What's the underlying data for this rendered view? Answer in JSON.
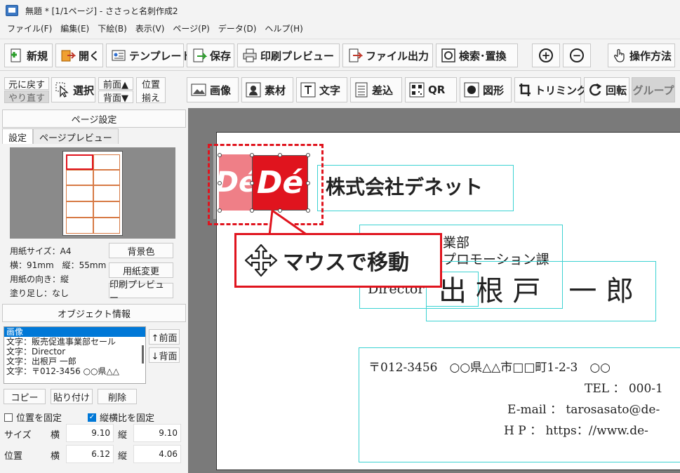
{
  "window": {
    "title": "無題 * [1/1ページ] - ささっと名刺作成2"
  },
  "menu": [
    "ファイル(F)",
    "編集(E)",
    "下絵(B)",
    "表示(V)",
    "ページ(P)",
    "データ(D)",
    "ヘルプ(H)"
  ],
  "toolbar1": {
    "new": "新規",
    "open": "開く",
    "template": "テンプレート",
    "save": "保存",
    "print_preview": "印刷プレビュー",
    "file_output": "ファイル出力",
    "search_replace": "検索･置換",
    "help": "操作方法"
  },
  "toolbar2": {
    "undo": "元に戻す",
    "redo": "やり直す",
    "select": "選択",
    "front": "前面▲",
    "back": "背面▼",
    "align_1": "位置",
    "align_2": "揃え",
    "image": "画像",
    "material": "素材",
    "text": "文字",
    "merge": "差込",
    "qr": "QR",
    "shape": "図形",
    "trimming": "トリミング",
    "rotate": "回転",
    "group": "グループ"
  },
  "left_panel": {
    "page_settings_title": "ページ設定",
    "tabs": [
      "設定",
      "ページプレビュー"
    ],
    "paper_size": "用紙サイズ：A4",
    "dimensions": "横：91mm　縦：55mm",
    "orientation": "用紙の向き：縦",
    "bleed": "塗り足し：なし",
    "bg_color_btn": "背景色",
    "paper_change_btn": "用紙変更",
    "print_preview_btn": "印刷プレビュー",
    "object_info_title": "オブジェクト情報",
    "objects": [
      "画像",
      "文字：販売促進事業部セール",
      "文字：Director",
      "文字：出根戸 一郎",
      "文字：〒012-3456 ○○県△△"
    ],
    "front_btn": "↑前面",
    "back_btn": "↓背面",
    "copy_btn": "コピー",
    "paste_btn": "貼り付け",
    "delete_btn": "削除",
    "fix_position": "位置を固定",
    "fix_aspect": "縦横比を固定",
    "size_label": "サイズ",
    "position_label": "位置",
    "width_label": "横",
    "height_label": "縦",
    "size_w": "9.10",
    "size_h": "9.10",
    "pos_x": "6.12",
    "pos_y": "4.06"
  },
  "card": {
    "logo_text": "Dé",
    "company": "株式会社デネット",
    "dept_1": "業部",
    "dept_2": "プロモーション課",
    "title": "Director",
    "name": "出 根 戸　一 郎",
    "address": "〒012-3456　○○県△△市□□町1-2-3　○○",
    "tel": "TEL ： 000-1",
    "email": "E-mail ： tarosasato@de-",
    "hp": "H P ： https：//www.de-"
  },
  "callout": {
    "text": "マウスで移動"
  },
  "colors": {
    "accent_red": "#e0141e",
    "textbox_cyan": "#3cd2d2",
    "selected_blue": "#0078d7"
  }
}
